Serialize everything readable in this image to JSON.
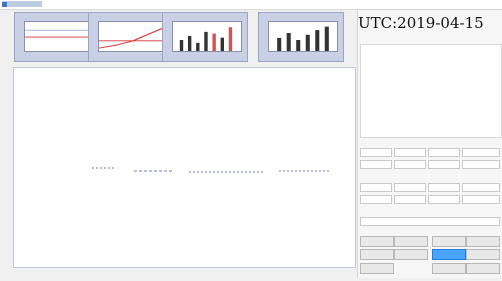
{
  "window": {
    "title": "",
    "app_title": ""
  },
  "thumbs": [
    {
      "title": ""
    },
    {
      "title": ""
    },
    {
      "title": ""
    },
    {
      "title": ""
    }
  ],
  "main_chart": {
    "header": "",
    "xlabel": "",
    "ylabel": ""
  },
  "chart_data": {
    "type": "scatter",
    "title": "",
    "x": [],
    "y": []
  },
  "sidebar": {
    "utc": "UTC:2019-04-15",
    "satellite_columns": [
      "",
      "",
      "",
      "",
      "",
      ""
    ]
  },
  "panel": {
    "sections": [
      {
        "title": ""
      },
      {
        "title": ""
      },
      {
        "title": ""
      },
      {
        "title": ""
      }
    ],
    "buttons": [
      "",
      "",
      "",
      "",
      "",
      "",
      "",
      ""
    ]
  },
  "colors": {
    "accent": "#4aa3ff",
    "chart_border": "#bfc7d8",
    "thumb_bg": "#c9d0e6"
  }
}
